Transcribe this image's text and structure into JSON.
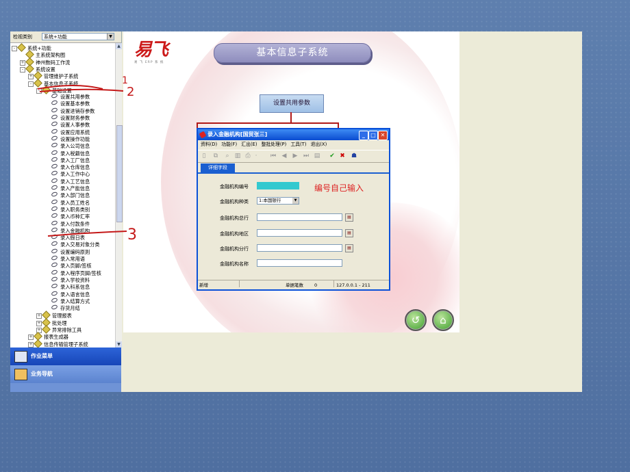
{
  "tree_panel": {
    "filter_label": "检视类别",
    "filter_value": "系统+功能",
    "items": [
      {
        "label": "系统+功能",
        "level": 0,
        "kind": "folder",
        "pm": "-"
      },
      {
        "label": "主系统架构图",
        "level": 1,
        "kind": "folder",
        "pm": ""
      },
      {
        "label": "神州数码工作流",
        "level": 1,
        "kind": "folder",
        "pm": "+"
      },
      {
        "label": "系统设置",
        "level": 1,
        "kind": "folder",
        "pm": "-"
      },
      {
        "label": "管理维护子系统",
        "level": 2,
        "kind": "folder",
        "pm": "+"
      },
      {
        "label": "基本信息子系统",
        "level": 2,
        "kind": "folder",
        "pm": "-"
      },
      {
        "label": "基础设置",
        "level": 3,
        "kind": "folder",
        "pm": "-"
      },
      {
        "label": "设置共用参数",
        "level": 4,
        "kind": "leaf",
        "pm": ""
      },
      {
        "label": "设置基本参数",
        "level": 4,
        "kind": "leaf",
        "pm": ""
      },
      {
        "label": "设置进销存参数",
        "level": 4,
        "kind": "leaf",
        "pm": ""
      },
      {
        "label": "设置财务参数",
        "level": 4,
        "kind": "leaf",
        "pm": ""
      },
      {
        "label": "设置人事参数",
        "level": 4,
        "kind": "leaf",
        "pm": ""
      },
      {
        "label": "设置应用系统",
        "level": 4,
        "kind": "leaf",
        "pm": ""
      },
      {
        "label": "设置操作功能",
        "level": 4,
        "kind": "leaf",
        "pm": ""
      },
      {
        "label": "录入公司信息",
        "level": 4,
        "kind": "leaf",
        "pm": ""
      },
      {
        "label": "录入税籍信息",
        "level": 4,
        "kind": "leaf",
        "pm": ""
      },
      {
        "label": "录入工厂信息",
        "level": 4,
        "kind": "leaf",
        "pm": ""
      },
      {
        "label": "录入仓库信息",
        "level": 4,
        "kind": "leaf",
        "pm": ""
      },
      {
        "label": "录入工作中心",
        "level": 4,
        "kind": "leaf",
        "pm": ""
      },
      {
        "label": "录入工艺信息",
        "level": 4,
        "kind": "leaf",
        "pm": ""
      },
      {
        "label": "录入产能信息",
        "level": 4,
        "kind": "leaf",
        "pm": ""
      },
      {
        "label": "录入部门信息",
        "level": 4,
        "kind": "leaf",
        "pm": ""
      },
      {
        "label": "录入员工姓名",
        "level": 4,
        "kind": "leaf",
        "pm": ""
      },
      {
        "label": "录入职务类别",
        "level": 4,
        "kind": "leaf",
        "pm": ""
      },
      {
        "label": "录入币种汇率",
        "level": 4,
        "kind": "leaf",
        "pm": ""
      },
      {
        "label": "录入付款条件",
        "level": 4,
        "kind": "leaf",
        "pm": ""
      },
      {
        "label": "录入金融机构",
        "level": 4,
        "kind": "leaf",
        "pm": ""
      },
      {
        "label": "录入假日表",
        "level": 4,
        "kind": "leaf",
        "pm": ""
      },
      {
        "label": "录入交易对象分类",
        "level": 4,
        "kind": "leaf",
        "pm": ""
      },
      {
        "label": "设置编码原则",
        "level": 4,
        "kind": "leaf",
        "pm": ""
      },
      {
        "label": "录入常用语",
        "level": 4,
        "kind": "leaf",
        "pm": ""
      },
      {
        "label": "录入页脚/签核",
        "level": 4,
        "kind": "leaf",
        "pm": ""
      },
      {
        "label": "录入程序页脚/签核",
        "level": 4,
        "kind": "leaf",
        "pm": ""
      },
      {
        "label": "录入学校资料",
        "level": 4,
        "kind": "leaf",
        "pm": ""
      },
      {
        "label": "录入科系信息",
        "level": 4,
        "kind": "leaf",
        "pm": ""
      },
      {
        "label": "录入语言信息",
        "level": 4,
        "kind": "leaf",
        "pm": ""
      },
      {
        "label": "录入结算方式",
        "level": 4,
        "kind": "leaf",
        "pm": ""
      },
      {
        "label": "存货月结",
        "level": 4,
        "kind": "leaf",
        "pm": ""
      },
      {
        "label": "管理报表",
        "level": 3,
        "kind": "folder",
        "pm": "+"
      },
      {
        "label": "批处理",
        "level": 3,
        "kind": "folder",
        "pm": "+"
      },
      {
        "label": "异常排除工具",
        "level": 3,
        "kind": "folder",
        "pm": "+"
      },
      {
        "label": "报表生成器",
        "level": 2,
        "kind": "folder",
        "pm": "+"
      },
      {
        "label": "信息传输管理子系统",
        "level": 2,
        "kind": "folder",
        "pm": "+"
      }
    ]
  },
  "bottom_nav": {
    "work_menu": "作业菜单",
    "biz_nav": "业务导航"
  },
  "main": {
    "logo_text": "易飞",
    "logo_sub": "易 飞 ERP 系 统",
    "banner": "基本信息子系统",
    "param_box": "设置共用参数",
    "colors": {
      "accent_red": "#b01818",
      "title_blue": "#0a4bd0",
      "code_fill": "#33c9cf"
    }
  },
  "dialog": {
    "title": "录入金融机构[国贸张三]",
    "menu": [
      "资料(D)",
      "功能(F)",
      "汇出(E)",
      "整批处理(P)",
      "工具(T)",
      "退出(X)"
    ],
    "tab": "详细字段",
    "fields": {
      "code_label": "金融机构编号",
      "type_label": "金融机构种类",
      "type_value": "1:本国银行",
      "head_label": "金融机构总行",
      "region_label": "金融机构地区",
      "branch_label": "金融机构分行",
      "name_label": "金融机构名称"
    },
    "hint": "编号自己输入",
    "status": {
      "mode": "新增",
      "count_label": "单据笔数",
      "count": "0",
      "server": "127.0.0.1 - 211"
    }
  },
  "annotations": {
    "a1": "1",
    "a2": "2",
    "a3": "3"
  }
}
